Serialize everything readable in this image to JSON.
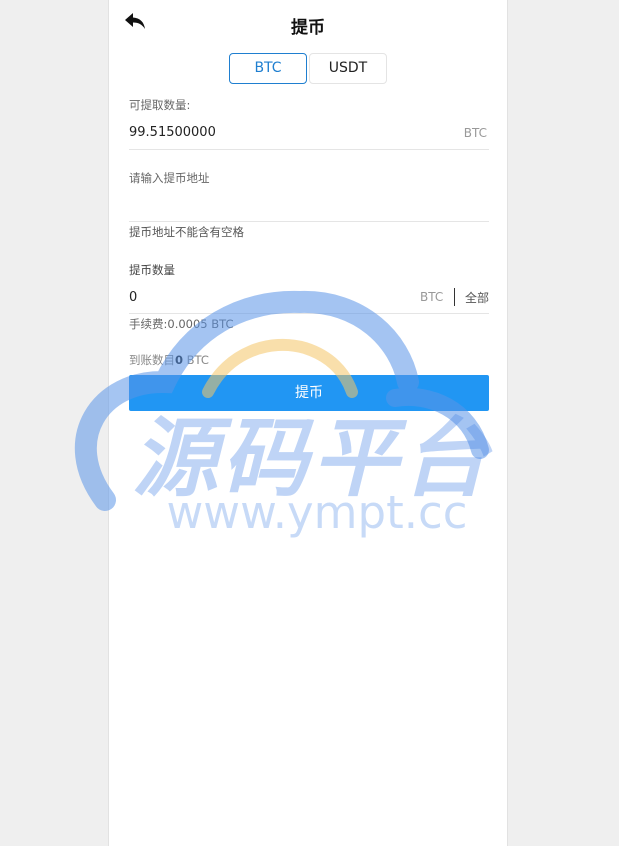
{
  "header": {
    "title": "提币",
    "back_icon": "back-arrow-icon"
  },
  "tabs": [
    {
      "label": "BTC",
      "active": true
    },
    {
      "label": "USDT",
      "active": false
    }
  ],
  "available": {
    "label": "可提取数量:",
    "value": "99.51500000",
    "unit": "BTC"
  },
  "address": {
    "label": "请输入提币地址",
    "value": "",
    "hint": "提币地址不能含有空格"
  },
  "amount": {
    "label": "提币数量",
    "value": "0",
    "unit": "BTC",
    "all_label": "全部"
  },
  "fee": {
    "text": "手续费:0.0005 BTC"
  },
  "received": {
    "label": "到账数目",
    "value": "0",
    "unit": " BTC"
  },
  "submit_label": "提币",
  "watermark": {
    "brand": "源码平台",
    "url": "www.ympt.cc"
  },
  "colors": {
    "accent": "#2196f3",
    "tab_active": "#1f7fd0",
    "background": "#efefef"
  }
}
